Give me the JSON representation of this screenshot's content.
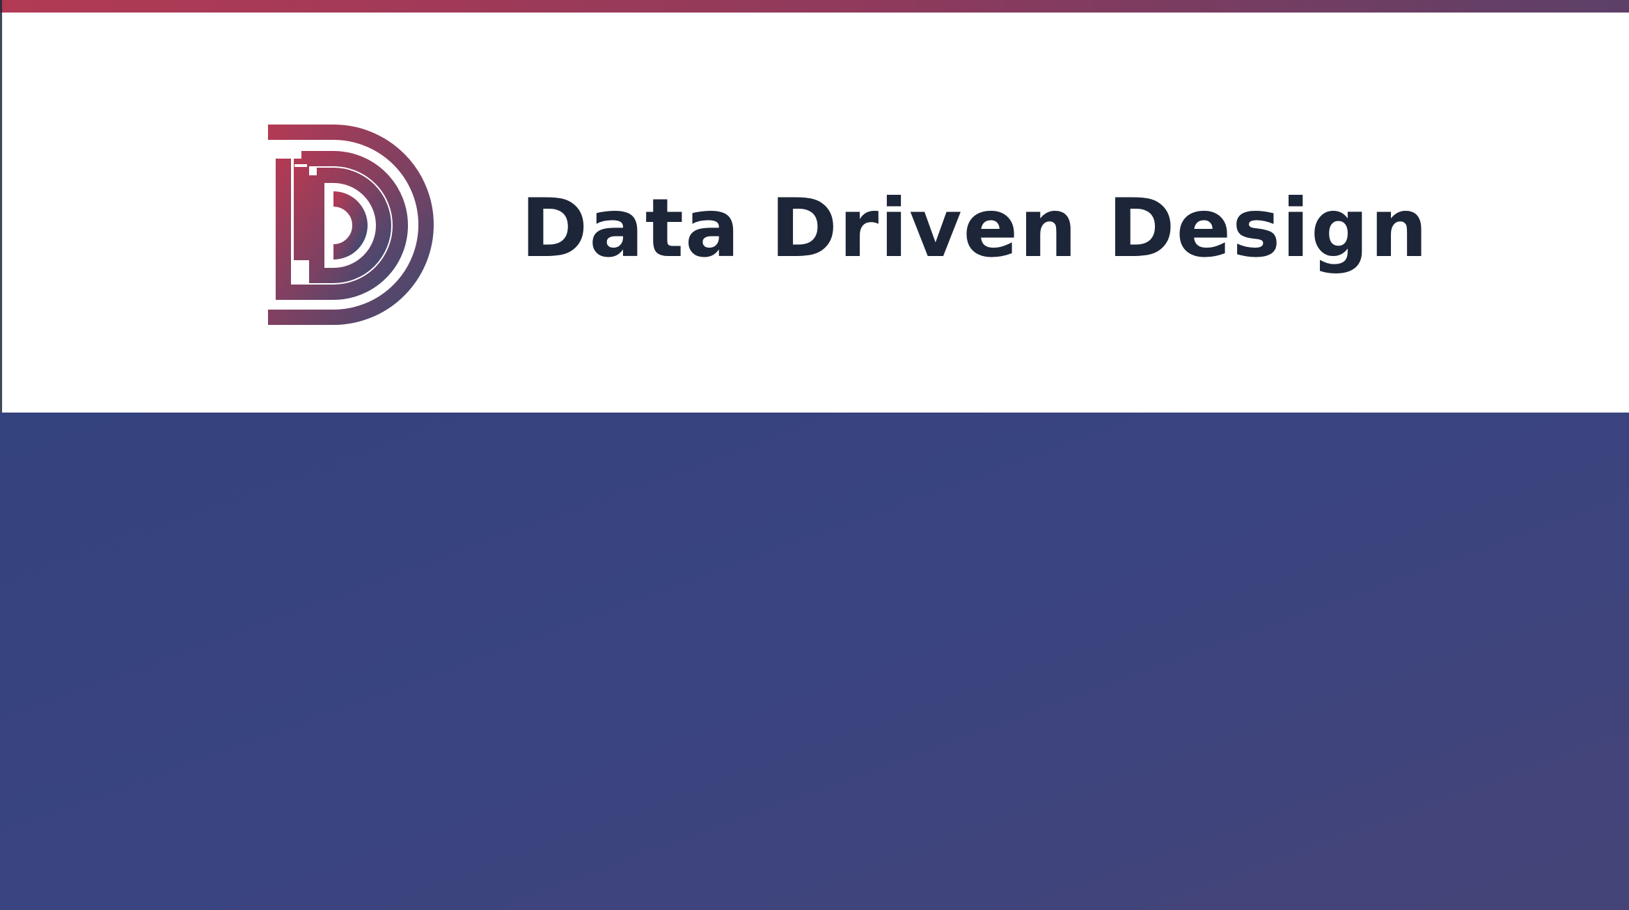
{
  "brand": {
    "name": "Data Driven Design",
    "logo_icon": "ddd-monogram-logo"
  },
  "colors": {
    "stripe_start": "#b23a54",
    "stripe_end": "#5c4068",
    "text": "#1c2638",
    "panel": "#3a4480"
  }
}
